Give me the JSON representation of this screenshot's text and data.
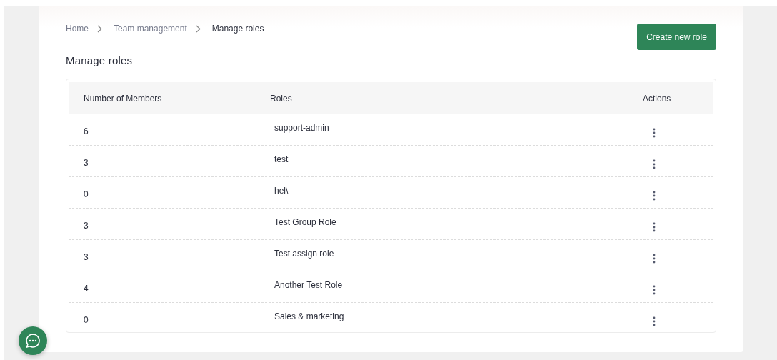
{
  "breadcrumbs": [
    {
      "label": "Home",
      "current": false
    },
    {
      "label": "Team management",
      "current": false
    },
    {
      "label": "Manage roles",
      "current": true
    }
  ],
  "create_button": "Create new role",
  "heading": "Manage roles",
  "table": {
    "columns": [
      "Number of Members",
      "Roles",
      "Actions"
    ],
    "rows": [
      {
        "members": "6",
        "role": "support-admin"
      },
      {
        "members": "3",
        "role": "test"
      },
      {
        "members": "0",
        "role": "hel\\"
      },
      {
        "members": "3",
        "role": "Test Group Role"
      },
      {
        "members": "3",
        "role": "Test assign role"
      },
      {
        "members": "4",
        "role": "Another Test Role"
      },
      {
        "members": "0",
        "role": "Sales & marketing"
      }
    ]
  }
}
